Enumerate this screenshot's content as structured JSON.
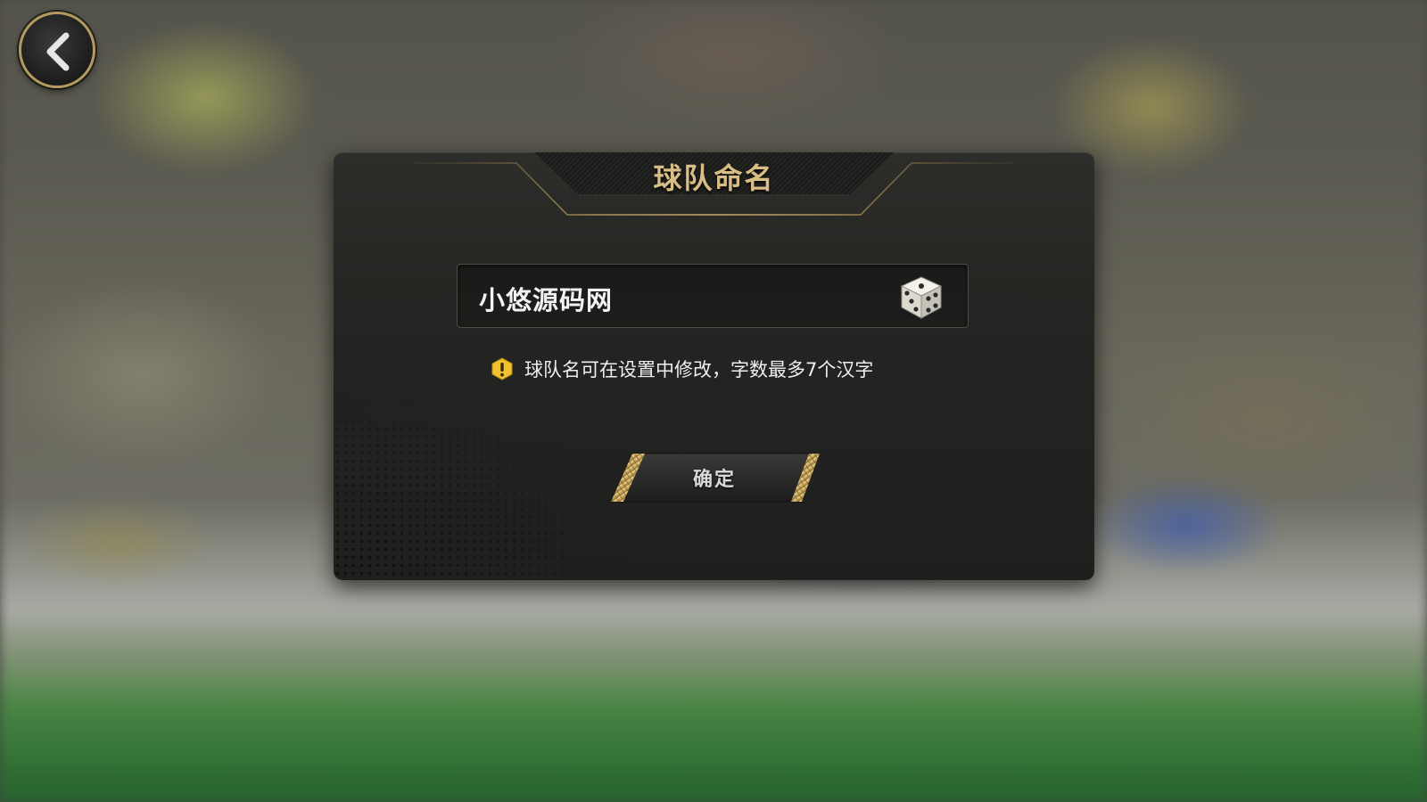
{
  "screen": {
    "title": "球队命名"
  },
  "team_name": {
    "value": "小悠源码网"
  },
  "hint": {
    "text": "球队名可在设置中修改，字数最多7个汉字"
  },
  "actions": {
    "confirm_label": "确定"
  },
  "icons": {
    "back": "chevron-left-icon",
    "random": "dice-icon",
    "warning": "warning-icon"
  },
  "colors": {
    "title_gold": "#d8be86",
    "accent_gold": "#c9a75c",
    "panel_dark": "#242422",
    "warning_yellow": "#f2c230"
  }
}
